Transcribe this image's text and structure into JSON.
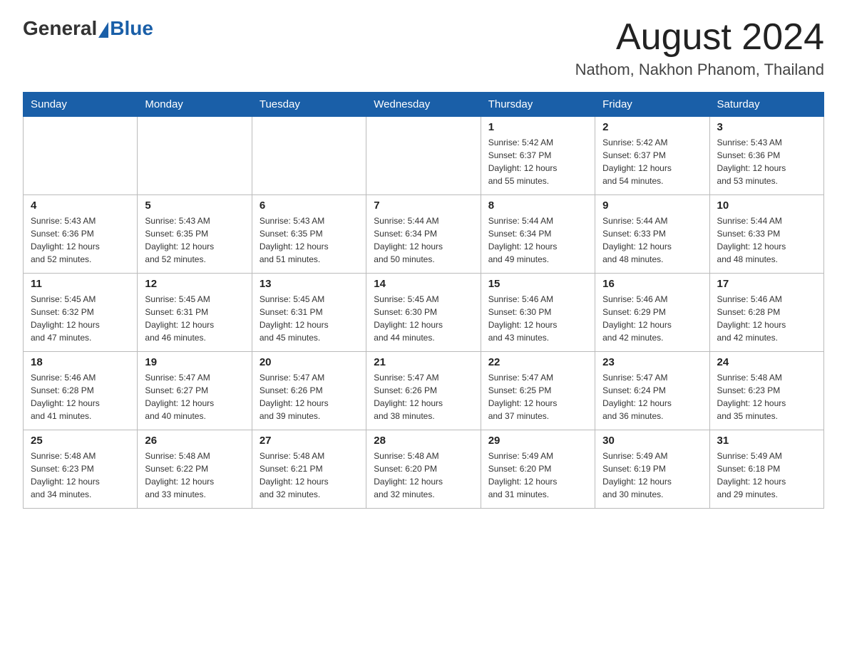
{
  "header": {
    "logo_general": "General",
    "logo_blue": "Blue",
    "title": "August 2024",
    "subtitle": "Nathom, Nakhon Phanom, Thailand"
  },
  "weekdays": [
    "Sunday",
    "Monday",
    "Tuesday",
    "Wednesday",
    "Thursday",
    "Friday",
    "Saturday"
  ],
  "weeks": [
    [
      {
        "day": "",
        "info": ""
      },
      {
        "day": "",
        "info": ""
      },
      {
        "day": "",
        "info": ""
      },
      {
        "day": "",
        "info": ""
      },
      {
        "day": "1",
        "info": "Sunrise: 5:42 AM\nSunset: 6:37 PM\nDaylight: 12 hours\nand 55 minutes."
      },
      {
        "day": "2",
        "info": "Sunrise: 5:42 AM\nSunset: 6:37 PM\nDaylight: 12 hours\nand 54 minutes."
      },
      {
        "day": "3",
        "info": "Sunrise: 5:43 AM\nSunset: 6:36 PM\nDaylight: 12 hours\nand 53 minutes."
      }
    ],
    [
      {
        "day": "4",
        "info": "Sunrise: 5:43 AM\nSunset: 6:36 PM\nDaylight: 12 hours\nand 52 minutes."
      },
      {
        "day": "5",
        "info": "Sunrise: 5:43 AM\nSunset: 6:35 PM\nDaylight: 12 hours\nand 52 minutes."
      },
      {
        "day": "6",
        "info": "Sunrise: 5:43 AM\nSunset: 6:35 PM\nDaylight: 12 hours\nand 51 minutes."
      },
      {
        "day": "7",
        "info": "Sunrise: 5:44 AM\nSunset: 6:34 PM\nDaylight: 12 hours\nand 50 minutes."
      },
      {
        "day": "8",
        "info": "Sunrise: 5:44 AM\nSunset: 6:34 PM\nDaylight: 12 hours\nand 49 minutes."
      },
      {
        "day": "9",
        "info": "Sunrise: 5:44 AM\nSunset: 6:33 PM\nDaylight: 12 hours\nand 48 minutes."
      },
      {
        "day": "10",
        "info": "Sunrise: 5:44 AM\nSunset: 6:33 PM\nDaylight: 12 hours\nand 48 minutes."
      }
    ],
    [
      {
        "day": "11",
        "info": "Sunrise: 5:45 AM\nSunset: 6:32 PM\nDaylight: 12 hours\nand 47 minutes."
      },
      {
        "day": "12",
        "info": "Sunrise: 5:45 AM\nSunset: 6:31 PM\nDaylight: 12 hours\nand 46 minutes."
      },
      {
        "day": "13",
        "info": "Sunrise: 5:45 AM\nSunset: 6:31 PM\nDaylight: 12 hours\nand 45 minutes."
      },
      {
        "day": "14",
        "info": "Sunrise: 5:45 AM\nSunset: 6:30 PM\nDaylight: 12 hours\nand 44 minutes."
      },
      {
        "day": "15",
        "info": "Sunrise: 5:46 AM\nSunset: 6:30 PM\nDaylight: 12 hours\nand 43 minutes."
      },
      {
        "day": "16",
        "info": "Sunrise: 5:46 AM\nSunset: 6:29 PM\nDaylight: 12 hours\nand 42 minutes."
      },
      {
        "day": "17",
        "info": "Sunrise: 5:46 AM\nSunset: 6:28 PM\nDaylight: 12 hours\nand 42 minutes."
      }
    ],
    [
      {
        "day": "18",
        "info": "Sunrise: 5:46 AM\nSunset: 6:28 PM\nDaylight: 12 hours\nand 41 minutes."
      },
      {
        "day": "19",
        "info": "Sunrise: 5:47 AM\nSunset: 6:27 PM\nDaylight: 12 hours\nand 40 minutes."
      },
      {
        "day": "20",
        "info": "Sunrise: 5:47 AM\nSunset: 6:26 PM\nDaylight: 12 hours\nand 39 minutes."
      },
      {
        "day": "21",
        "info": "Sunrise: 5:47 AM\nSunset: 6:26 PM\nDaylight: 12 hours\nand 38 minutes."
      },
      {
        "day": "22",
        "info": "Sunrise: 5:47 AM\nSunset: 6:25 PM\nDaylight: 12 hours\nand 37 minutes."
      },
      {
        "day": "23",
        "info": "Sunrise: 5:47 AM\nSunset: 6:24 PM\nDaylight: 12 hours\nand 36 minutes."
      },
      {
        "day": "24",
        "info": "Sunrise: 5:48 AM\nSunset: 6:23 PM\nDaylight: 12 hours\nand 35 minutes."
      }
    ],
    [
      {
        "day": "25",
        "info": "Sunrise: 5:48 AM\nSunset: 6:23 PM\nDaylight: 12 hours\nand 34 minutes."
      },
      {
        "day": "26",
        "info": "Sunrise: 5:48 AM\nSunset: 6:22 PM\nDaylight: 12 hours\nand 33 minutes."
      },
      {
        "day": "27",
        "info": "Sunrise: 5:48 AM\nSunset: 6:21 PM\nDaylight: 12 hours\nand 32 minutes."
      },
      {
        "day": "28",
        "info": "Sunrise: 5:48 AM\nSunset: 6:20 PM\nDaylight: 12 hours\nand 32 minutes."
      },
      {
        "day": "29",
        "info": "Sunrise: 5:49 AM\nSunset: 6:20 PM\nDaylight: 12 hours\nand 31 minutes."
      },
      {
        "day": "30",
        "info": "Sunrise: 5:49 AM\nSunset: 6:19 PM\nDaylight: 12 hours\nand 30 minutes."
      },
      {
        "day": "31",
        "info": "Sunrise: 5:49 AM\nSunset: 6:18 PM\nDaylight: 12 hours\nand 29 minutes."
      }
    ]
  ]
}
